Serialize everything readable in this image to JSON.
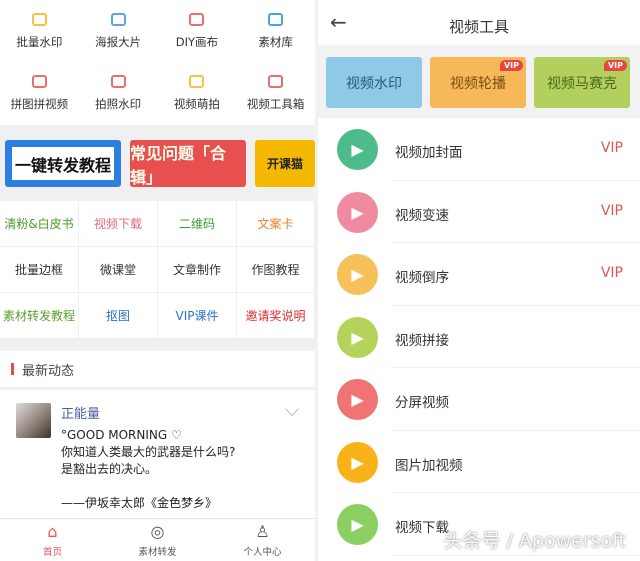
{
  "left": {
    "quick": [
      {
        "label": "批量水印",
        "icon": "image-icon",
        "color": "#f5c342"
      },
      {
        "label": "海报大片",
        "icon": "poster-icon",
        "color": "#5aa7e0"
      },
      {
        "label": "DIY画布",
        "icon": "canvas-icon",
        "color": "#ea6e6e"
      },
      {
        "label": "素材库",
        "icon": "layers-icon",
        "color": "#4da3d8"
      },
      {
        "label": "拼图拼视频",
        "icon": "collage-icon",
        "color": "#ea6e6e"
      },
      {
        "label": "拍照水印",
        "icon": "camera-icon",
        "color": "#ea6e6e"
      },
      {
        "label": "视频萌拍",
        "icon": "video-camera-icon",
        "color": "#f5c342"
      },
      {
        "label": "视频工具箱",
        "icon": "video-toolbox-icon",
        "color": "#ea6e6e"
      }
    ],
    "banners": [
      {
        "text": "一键转发教程",
        "bg": "#2b7fe0"
      },
      {
        "text": "常见问题「合辑」",
        "bg": "#e84f4f"
      },
      {
        "text": "开课猫",
        "bg": "#f5b800"
      }
    ],
    "links": [
      {
        "label": "清粉&白皮书",
        "color": "#4a9a2a"
      },
      {
        "label": "视频下载",
        "color": "#e06b7a"
      },
      {
        "label": "二维码",
        "color": "#3a9a3a"
      },
      {
        "label": "文案卡",
        "color": "#e8822a"
      },
      {
        "label": "批量边框",
        "color": "#333333"
      },
      {
        "label": "微课堂",
        "color": "#333333"
      },
      {
        "label": "文章制作",
        "color": "#333333"
      },
      {
        "label": "作图教程",
        "color": "#333333"
      },
      {
        "label": "素材转发教程",
        "color": "#5aa02a"
      },
      {
        "label": "抠图",
        "color": "#2a6fd0"
      },
      {
        "label": "VIP课件",
        "color": "#2a6fd0"
      },
      {
        "label": "邀请奖说明",
        "color": "#e02a2a"
      }
    ],
    "news_title": "最新动态",
    "post": {
      "author": "正能量",
      "text": "°GOOD MORNING ♡\n你知道人类最大的武器是什么吗?\n是豁出去的决心。\n\n——伊坂幸太郎《金色梦乡》"
    },
    "nav": [
      {
        "label": "首页",
        "icon": "home-icon",
        "active": true
      },
      {
        "label": "素材转发",
        "icon": "aperture-icon"
      },
      {
        "label": "个人中心",
        "icon": "user-icon"
      }
    ]
  },
  "right": {
    "title": "视频工具",
    "back_icon": "arrow-left-icon",
    "tiles": [
      {
        "label": "视频水印",
        "bg": "#8ec9e8",
        "vip": ""
      },
      {
        "label": "视频轮播",
        "bg": "#f7b85a",
        "vip": "VIP"
      },
      {
        "label": "视频马赛克",
        "bg": "#b3cf5e",
        "vip": "VIP"
      }
    ],
    "tools": [
      {
        "label": "视频加封面",
        "color": "#4dbb8a",
        "vip": "VIP",
        "icon": "video-cover-icon"
      },
      {
        "label": "视频变速",
        "color": "#ef8aa0",
        "vip": "VIP",
        "icon": "video-speed-icon"
      },
      {
        "label": "视频倒序",
        "color": "#f7c15a",
        "vip": "VIP",
        "icon": "video-reverse-icon"
      },
      {
        "label": "视频拼接",
        "color": "#b5d35a",
        "vip": "",
        "icon": "video-merge-icon"
      },
      {
        "label": "分屏视频",
        "color": "#f07474",
        "vip": "",
        "icon": "split-screen-icon"
      },
      {
        "label": "图片加视频",
        "color": "#f9b21a",
        "vip": "",
        "icon": "image-video-icon"
      },
      {
        "label": "视频下载",
        "color": "#8bcf62",
        "vip": "",
        "icon": "video-download-icon"
      }
    ]
  },
  "watermark": "头条号 / Apowersoft"
}
